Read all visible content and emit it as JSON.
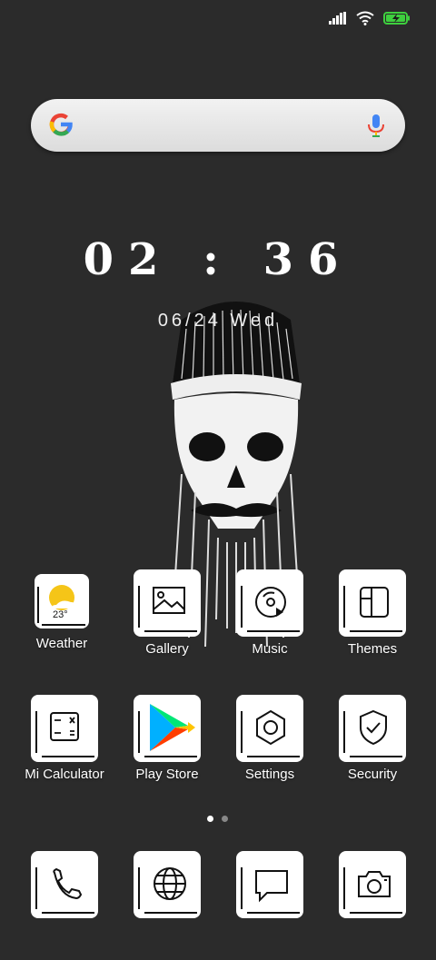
{
  "status": {
    "signal_icon": "signal-icon",
    "wifi_icon": "wifi-icon",
    "battery_icon": "battery-charging-icon",
    "battery_color": "#3ecf3e"
  },
  "search": {
    "logo_icon": "google-g-icon",
    "mic_icon": "mic-icon"
  },
  "clock": {
    "time": "02 : 36",
    "date": "06/24 Wed"
  },
  "apps_row1": [
    {
      "label": "Weather",
      "icon": "weather-icon",
      "temp": "23°"
    },
    {
      "label": "Gallery",
      "icon": "gallery-icon"
    },
    {
      "label": "Music",
      "icon": "music-icon"
    },
    {
      "label": "Themes",
      "icon": "themes-icon"
    }
  ],
  "apps_row2": [
    {
      "label": "Mi Calculator",
      "icon": "calculator-icon"
    },
    {
      "label": "Play Store",
      "icon": "play-store-icon"
    },
    {
      "label": "Settings",
      "icon": "settings-icon"
    },
    {
      "label": "Security",
      "icon": "security-icon"
    }
  ],
  "dock": [
    {
      "icon": "phone-icon"
    },
    {
      "icon": "browser-icon"
    },
    {
      "icon": "messages-icon"
    },
    {
      "icon": "camera-icon"
    }
  ],
  "pager": {
    "pages": 2,
    "current": 1
  }
}
